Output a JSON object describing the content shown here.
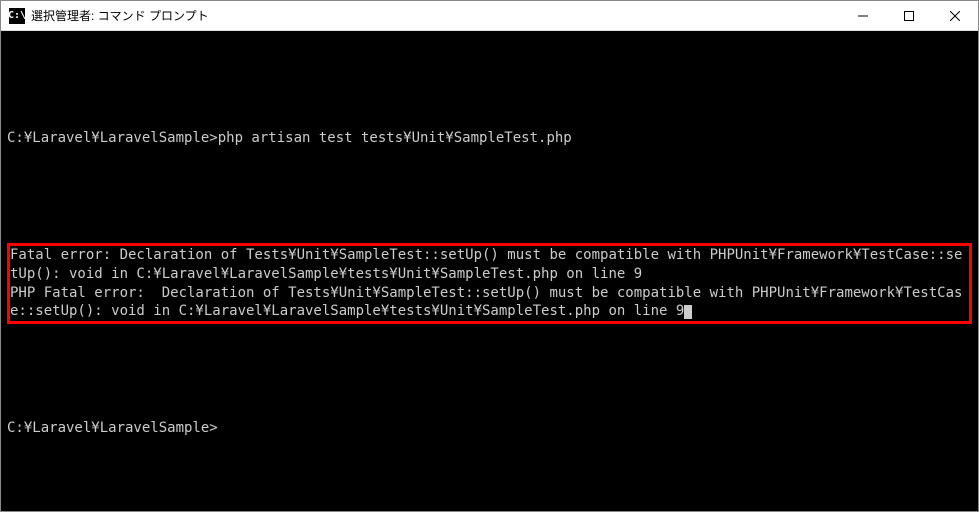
{
  "window": {
    "title": "選択管理者: コマンド プロンプト",
    "icon_label": "C:\\"
  },
  "terminal": {
    "command_line": "C:¥Laravel¥LaravelSample>php artisan test tests¥Unit¥SampleTest.php",
    "error_block": "Fatal error: Declaration of Tests¥Unit¥SampleTest::setUp() must be compatible with PHPUnit¥Framework¥TestCase::setUp(): void in C:¥Laravel¥LaravelSample¥tests¥Unit¥SampleTest.php on line 9\nPHP Fatal error:  Declaration of Tests¥Unit¥SampleTest::setUp() must be compatible with PHPUnit¥Framework¥TestCase::setUp(): void in C:¥Laravel¥LaravelSample¥tests¥Unit¥SampleTest.php on line 9",
    "prompt_line": "C:¥Laravel¥LaravelSample>"
  }
}
